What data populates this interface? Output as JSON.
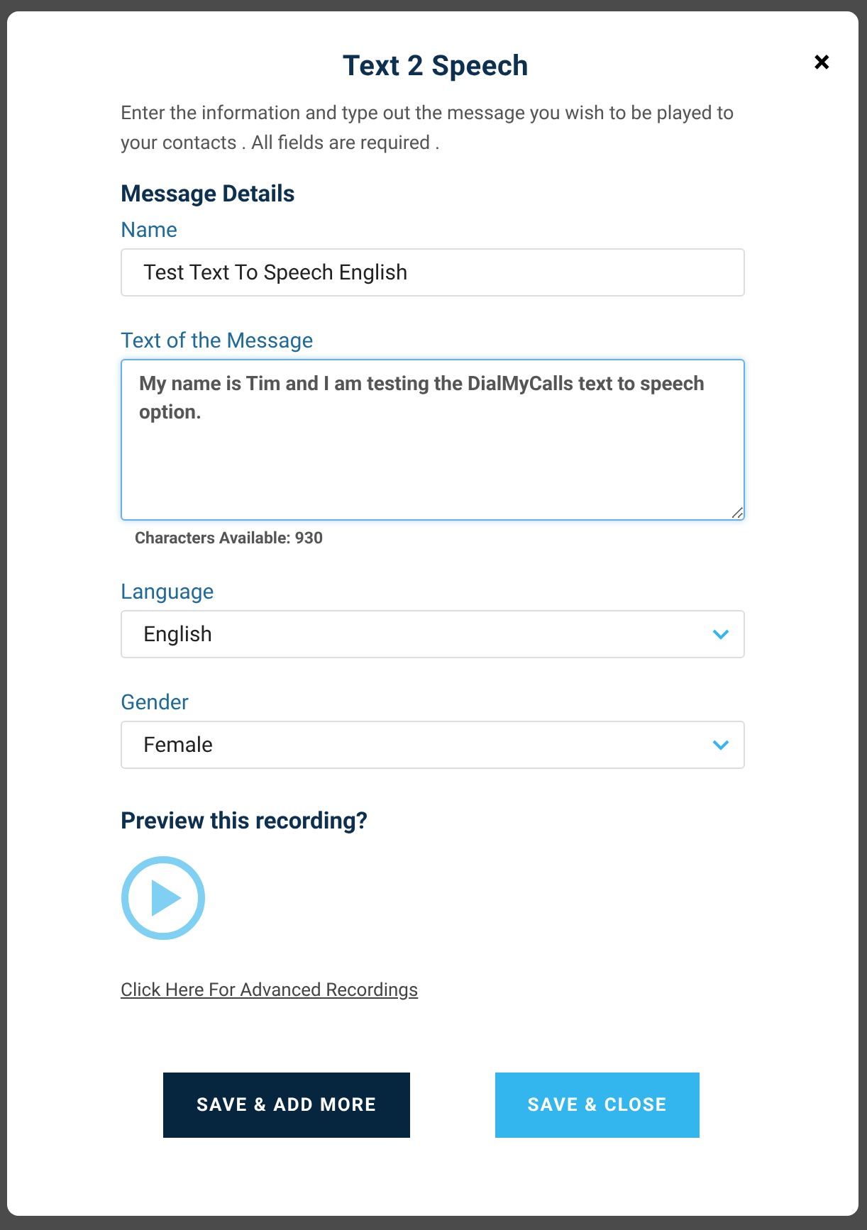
{
  "dialog": {
    "title": "Text 2 Speech",
    "close": "×",
    "description": "Enter the information and type out the message you wish to be played to your contacts . All fields are required ."
  },
  "section_title": "Message Details",
  "fields": [
    {
      "kind": "text",
      "label": "Name",
      "value": "Test Text To Speech English",
      "focused": false
    },
    {
      "kind": "textarea",
      "label": "Text of the Message",
      "value": "My name is Tim and I am testing the DialMyCalls text to speech option.",
      "focused": true,
      "hint": "Characters Available: 930"
    },
    {
      "kind": "select",
      "label": "Language",
      "value": "English",
      "focused": false
    },
    {
      "kind": "select",
      "label": "Gender",
      "value": "Female",
      "focused": false
    }
  ],
  "preview": {
    "title": "Preview this recording?"
  },
  "advanced_link": "Click Here For Advanced Recordings",
  "buttons": [
    {
      "label": "SAVE & ADD MORE",
      "kind": "dark"
    },
    {
      "label": "SAVE & CLOSE",
      "kind": "light"
    }
  ]
}
